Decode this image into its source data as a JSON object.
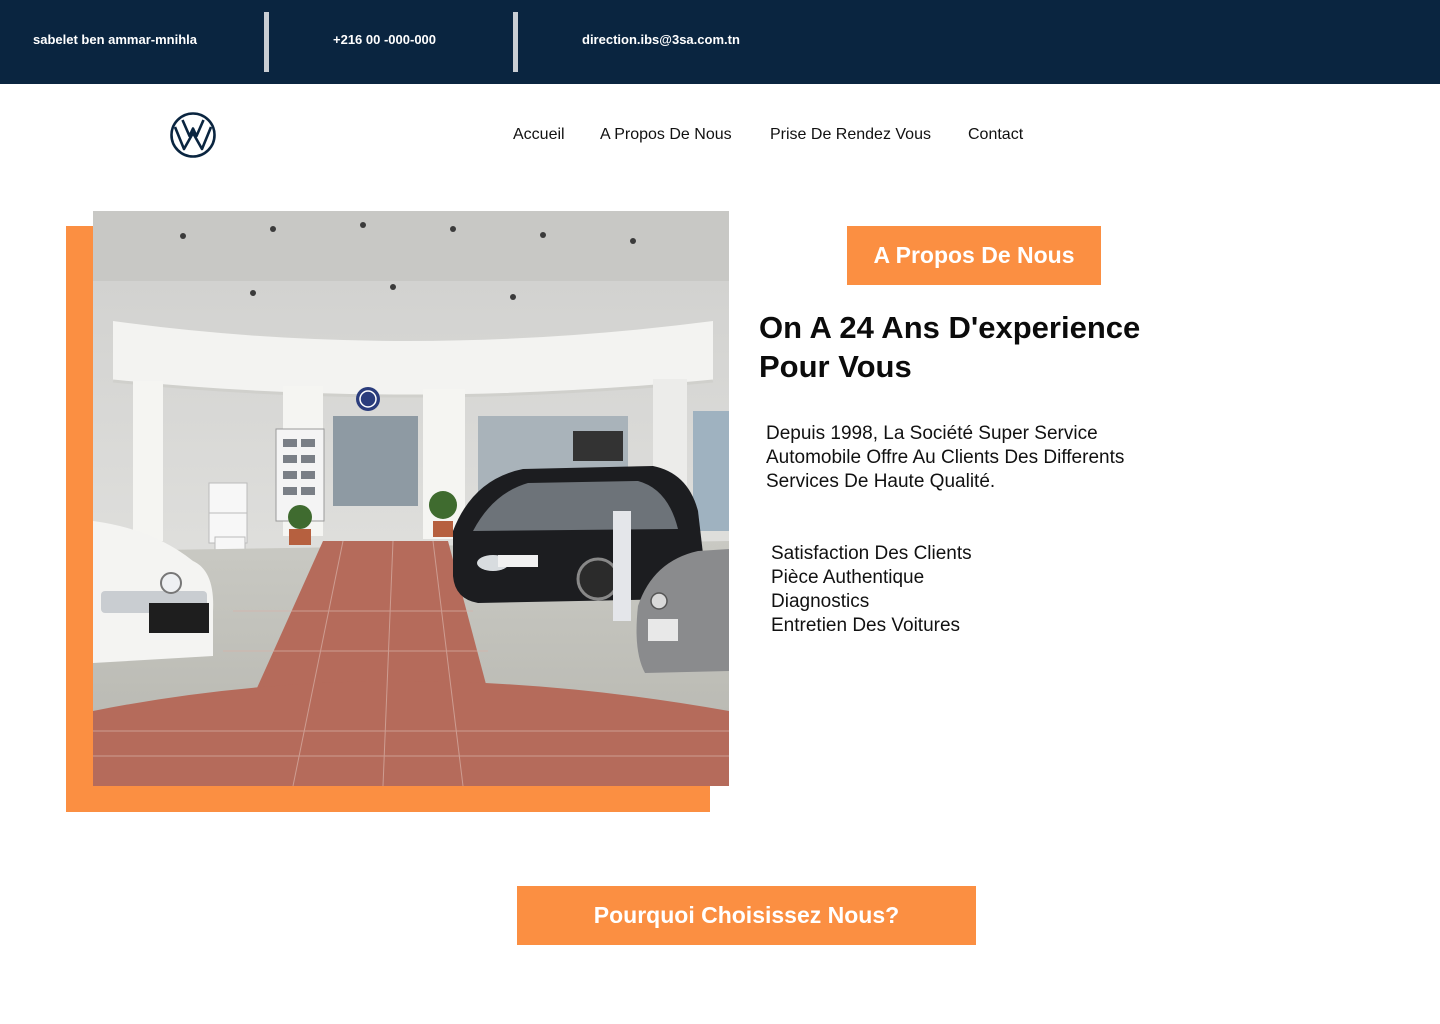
{
  "topbar": {
    "address": "sabelet ben ammar-mnihla",
    "phone": "+216 00 -000-000",
    "email": "direction.ibs@3sa.com.tn"
  },
  "brand": {
    "logo_icon": "volkswagen-logo-icon",
    "color": "#0a2540"
  },
  "nav": {
    "items": [
      {
        "label": "Accueil"
      },
      {
        "label": "A Propos De Nous"
      },
      {
        "label": "Prise De Rendez Vous"
      },
      {
        "label": "Contact"
      }
    ]
  },
  "about": {
    "badge": "A Propos De Nous",
    "headline_line1": "On A 24 Ans D'experience",
    "headline_line2": "Pour Vous",
    "intro_line1": "Depuis 1998, La Société Super Service",
    "intro_line2": "Automobile Offre Au Clients Des Differents",
    "intro_line3": "Services De Haute Qualité.",
    "features": [
      "Satisfaction Des Clients",
      "Pièce Authentique",
      "Diagnostics",
      "Entretien Des Voitures"
    ],
    "image": "volkswagen-showroom-photo"
  },
  "why": {
    "badge": "Pourquoi Choisissez Nous?"
  },
  "colors": {
    "accent": "#fb8f42",
    "topbar": "#0a2540",
    "text": "#111111"
  }
}
